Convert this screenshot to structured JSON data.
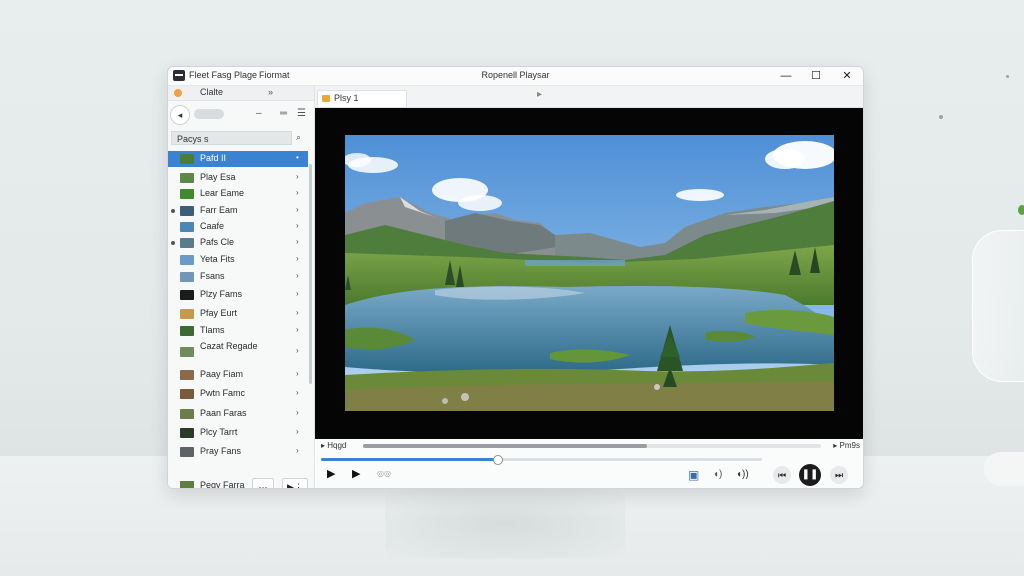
{
  "window": {
    "title": "Ropenell Playsar",
    "menu": [
      "Fleet Fasg",
      "Plage",
      "Fiormat"
    ],
    "controls": {
      "minimize": "—",
      "maximize": "☐",
      "close": "✕"
    }
  },
  "sidebar": {
    "top_label": "Clalte",
    "top_forward": "»",
    "search_placeholder": "Pacys s",
    "items": [
      {
        "label": "Pafd II",
        "chev": "•",
        "thumb": "#4a7d3a",
        "bullet": false,
        "selected": true
      },
      {
        "label": "Play Esa",
        "chev": "›",
        "thumb": "#5c8a46",
        "bullet": false
      },
      {
        "label": "Lear Eame",
        "chev": "›",
        "thumb": "#3f8a2c",
        "bullet": false
      },
      {
        "label": "Farr Eam",
        "chev": "›",
        "thumb": "#3b5f78",
        "bullet": true
      },
      {
        "label": "Caafe",
        "chev": "›",
        "thumb": "#4d86b5",
        "bullet": false
      },
      {
        "label": "Pafs Cle",
        "chev": "›",
        "thumb": "#5a7b8a",
        "bullet": true
      },
      {
        "label": "Yeta Fits",
        "chev": "›",
        "thumb": "#6a9ac6",
        "bullet": false
      },
      {
        "label": "Fsans",
        "chev": "›",
        "thumb": "#7296b8",
        "bullet": false
      },
      {
        "label": "Plzy Fams",
        "chev": "›",
        "thumb": "#1b1b1b",
        "bullet": false
      },
      {
        "label": "Pfay Eurt",
        "chev": "›",
        "thumb": "#c59a4a",
        "bullet": false
      },
      {
        "label": "Tlams",
        "chev": "›",
        "thumb": "#3d6a33",
        "bullet": false
      },
      {
        "label": "Cazat Regade",
        "chev": "›",
        "thumb": "#6f8d5c",
        "bullet": false
      },
      {
        "label": "Paay Fiam",
        "chev": "›",
        "thumb": "#8a6a4a",
        "bullet": false
      },
      {
        "label": "Pwtn Famc",
        "chev": "›",
        "thumb": "#7a5a3a",
        "bullet": false
      },
      {
        "label": "Paan Faras",
        "chev": "›",
        "thumb": "#6d7d4a",
        "bullet": false
      },
      {
        "label": "Plcy Tarrt",
        "chev": "›",
        "thumb": "#2a3b2a",
        "bullet": false
      },
      {
        "label": "Pray Fans",
        "chev": "›",
        "thumb": "#5d6468",
        "bullet": false
      }
    ],
    "bottom_item": {
      "label": "Pegy Farra",
      "thumb": "#5c7f3e"
    },
    "bottom_buttons": {
      "more": "···",
      "play": "▶⋮"
    }
  },
  "tab": {
    "label": "Plsy 1",
    "arrow": "▸"
  },
  "playback": {
    "time_left": "Hqgd",
    "time_right": "Pm9s",
    "top_progress": 0.62,
    "seek_progress": 0.4
  },
  "controls": {
    "play": "▶",
    "next_frame": "▶",
    "speed": "◎◎",
    "subtitles": "▣",
    "volume_low": "◖)",
    "volume_high": "◖))",
    "prev": "⏮",
    "pause": "❚❚",
    "next": "⏭"
  }
}
